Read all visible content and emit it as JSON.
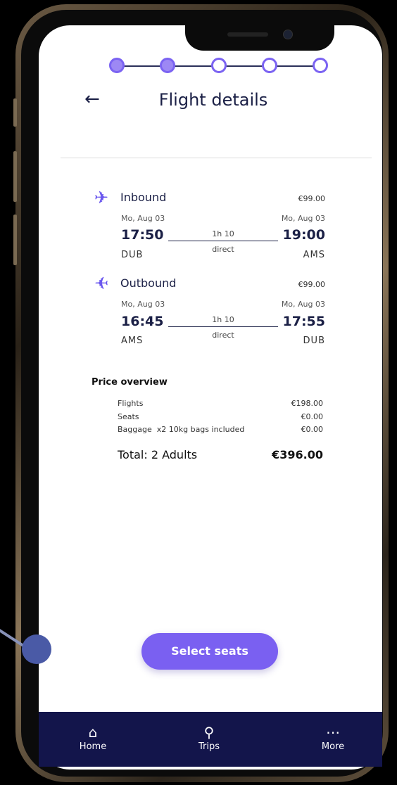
{
  "header": {
    "title": "Flight details",
    "back_icon": "arrow-left-icon"
  },
  "stepper": {
    "total_steps": 5,
    "completed_steps": 2
  },
  "inbound": {
    "label": "Inbound",
    "price": "€99.00",
    "dep_date": "Mo, Aug 03",
    "arr_date": "Mo, Aug 03",
    "dep_time": "17:50",
    "arr_time": "19:00",
    "duration": "1h 10",
    "stops": "direct",
    "from": "DUB",
    "to": "AMS"
  },
  "outbound": {
    "label": "Outbound",
    "price": "€99.00",
    "dep_date": "Mo, Aug 03",
    "arr_date": "Mo, Aug 03",
    "dep_time": "16:45",
    "arr_time": "17:55",
    "duration": "1h 10",
    "stops": "direct",
    "from": "AMS",
    "to": "DUB"
  },
  "price_overview": {
    "heading": "Price overview",
    "flights_label": "Flights",
    "flights_value": "€198.00",
    "seats_label": "Seats",
    "seats_value": "€0.00",
    "baggage_label": "Baggage  x2 10kg bags included",
    "baggage_value": "€0.00",
    "total_label": "Total: 2 Adults",
    "total_value": "€396.00"
  },
  "cta": {
    "label": "Select seats"
  },
  "nav": {
    "home": "Home",
    "trips": "Trips",
    "more": "More"
  },
  "colors": {
    "accent": "#7a60f1",
    "nav_bg": "#13154b",
    "text": "#1b2046"
  }
}
